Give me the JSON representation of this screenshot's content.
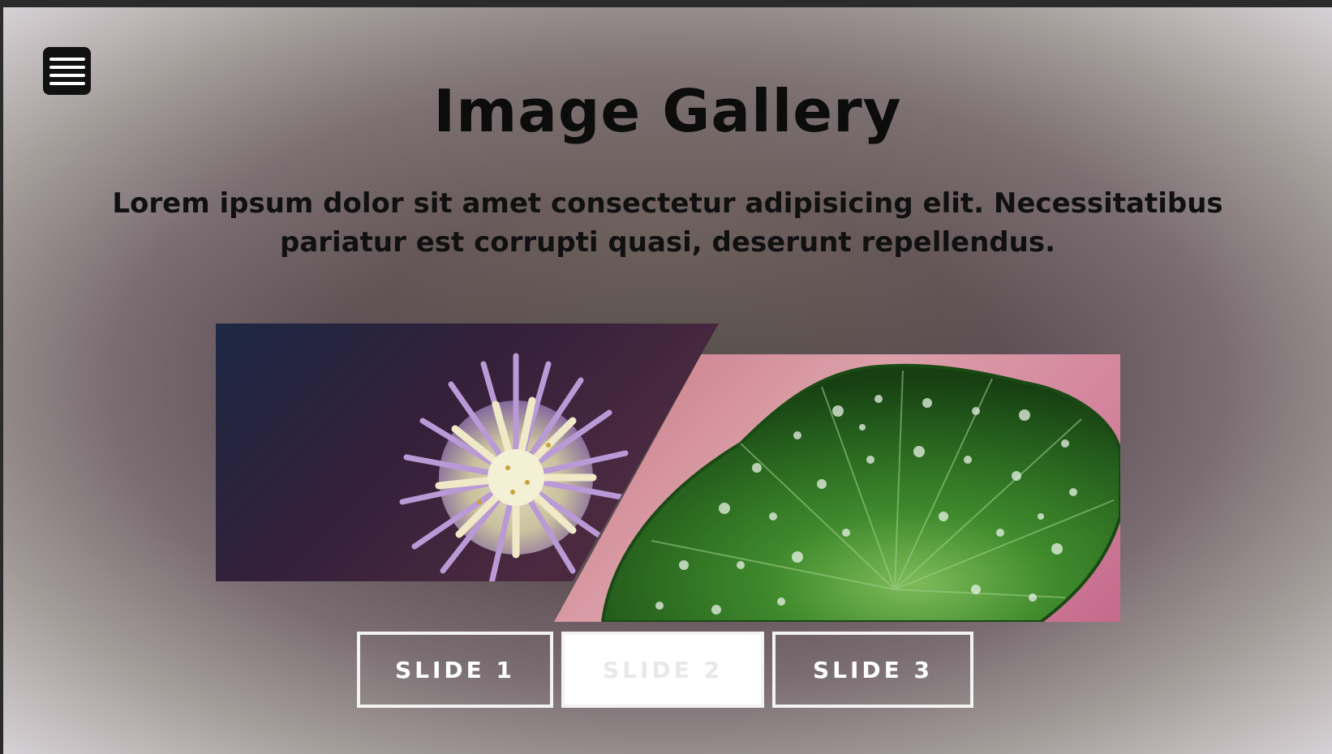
{
  "header": {
    "menu_icon": "hamburger-menu-icon",
    "title": "Image Gallery",
    "description": "Lorem ipsum dolor sit amet consectetur adipisicing elit. Necessitatibus pariatur est corrupti quasi, deserunt repellendus."
  },
  "gallery": {
    "slides": [
      {
        "image": "purple-flower"
      },
      {
        "image": "green-leaf-with-water-drops"
      }
    ],
    "buttons": [
      {
        "label": "SLIDE 1"
      },
      {
        "label": "SLIDE 2",
        "state": "active"
      },
      {
        "label": "SLIDE 3"
      }
    ]
  },
  "colors": {
    "button_border": "#f3f3f3",
    "active_button_bg": "#ffffff",
    "menu_bg": "#111111",
    "title_text": "#0c0c0c"
  }
}
